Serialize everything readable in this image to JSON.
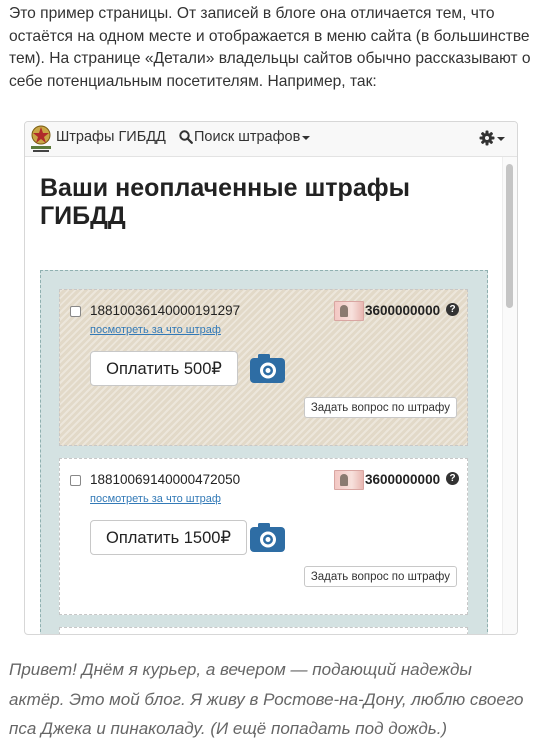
{
  "intro_text": "Это пример страницы. От записей в блоге она отличается тем, что остаётся на одном месте и отображается в меню сайта (в большинстве тем). На странице «Детали» владельцы сайтов обычно рассказывают о себе потенциальным посетителям. Например, так:",
  "app": {
    "brand_title": "Штрафы ГИБДД",
    "search_label": "Поиск штрафов",
    "page_title": "Ваши неоплаченные штрафы ГИБДД"
  },
  "fines": [
    {
      "number": "18810036140000191297",
      "details_link": "посмотреть за что штраф",
      "document_code": "3600000000",
      "pay_label": "Оплатить 500₽",
      "ask_label": "Задать вопрос по штрафу",
      "highlighted": true
    },
    {
      "number": "18810069140000472050",
      "details_link": "посмотреть за что штраф",
      "document_code": "3600000000",
      "pay_label": "Оплатить 1500₽",
      "ask_label": "Задать вопрос по штрафу",
      "highlighted": false
    }
  ],
  "outro_text": "Привет! Днём я курьер, а вечером — подающий надежды актёр. Это мой блог. Я живу в Ростове-на-Дону, люблю своего пса Джека и пинаколаду. (И ещё попадать под дождь.)",
  "colors": {
    "panel_bg": "#d4e2e2",
    "card_highlight": "#e2d9c8",
    "camera_blue": "#2e6da4",
    "link_blue": "#337ab7"
  },
  "icons": [
    "gibdd-emblem-icon",
    "search-icon",
    "gear-icon",
    "help-icon",
    "camera-icon",
    "passport-icon"
  ]
}
